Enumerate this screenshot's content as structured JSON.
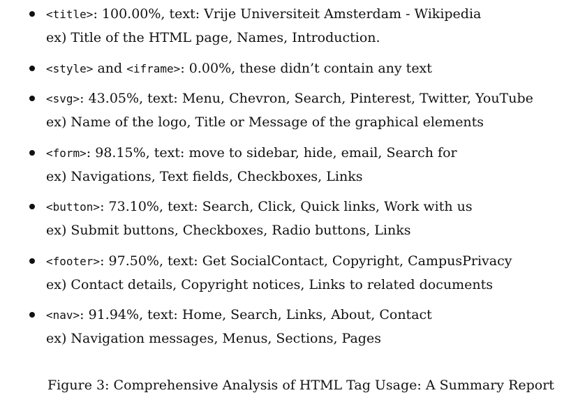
{
  "items": [
    {
      "tag": "<title>",
      "separator": ": ",
      "summary": "100.00%, text: Vrije Universiteit Amsterdam - Wikipedia",
      "example": "ex) Title of the HTML page, Names, Introduction."
    },
    {
      "tag": "<style>",
      "middle": " and ",
      "tag2": "<iframe>",
      "separator": ": ",
      "summary": "0.00%, these didn’t contain any text"
    },
    {
      "tag": "<svg>",
      "separator": ": ",
      "summary": "43.05%, text: Menu, Chevron, Search, Pinterest, Twitter, YouTube",
      "example": "ex) Name of the logo, Title or Message of the graphical elements"
    },
    {
      "tag": "<form>",
      "separator": ": ",
      "summary": "98.15%, text: move to sidebar, hide, email, Search for",
      "example": "ex) Navigations, Text fields, Checkboxes, Links"
    },
    {
      "tag": "<button>",
      "separator": ": ",
      "summary": "73.10%, text: Search, Click, Quick links, Work with us",
      "example": "ex) Submit buttons, Checkboxes, Radio buttons, Links"
    },
    {
      "tag": "<footer>",
      "separator": ": ",
      "summary": "97.50%, text: Get SocialContact, Copyright, CampusPrivacy",
      "example": "ex) Contact details, Copyright notices, Links to related documents"
    },
    {
      "tag": "<nav>",
      "separator": ": ",
      "summary": "91.94%, text: Home, Search, Links, About, Contact",
      "example": "ex) Navigation messages, Menus, Sections, Pages"
    }
  ],
  "caption": "Figure 3: Comprehensive Analysis of HTML Tag Usage: A Summary Report"
}
